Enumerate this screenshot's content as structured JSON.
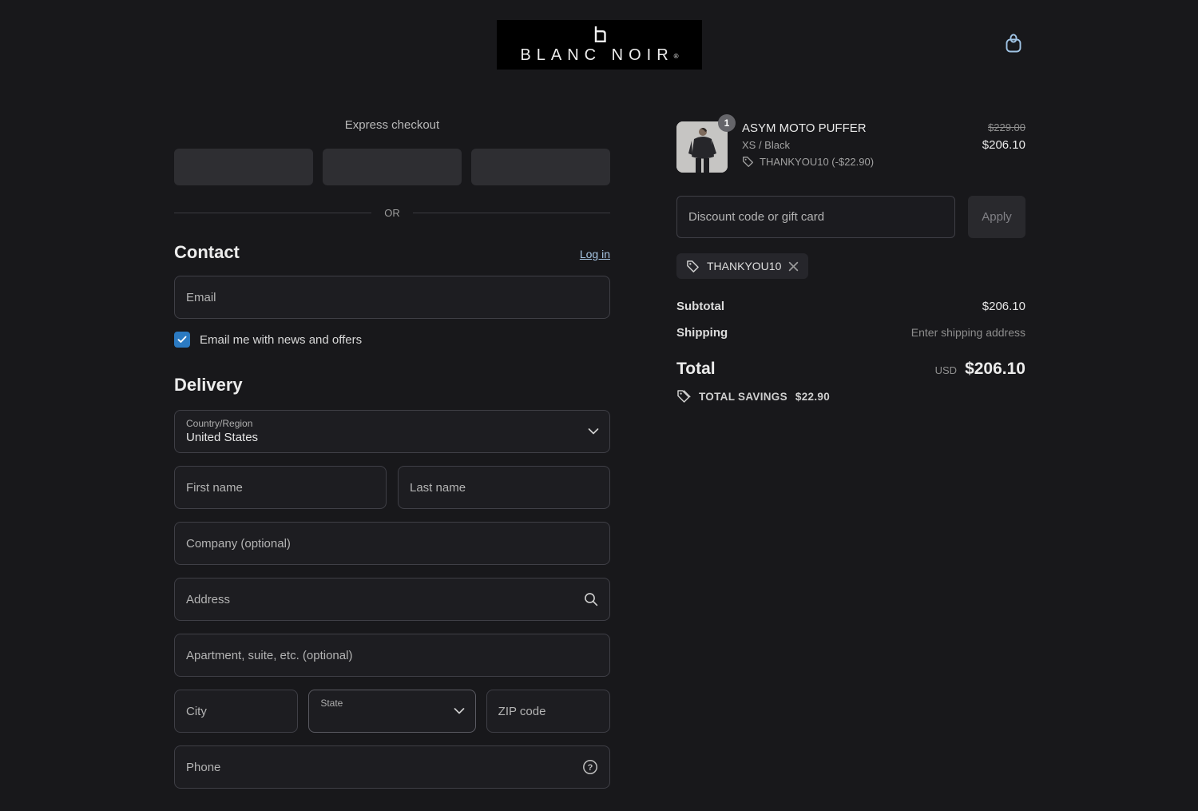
{
  "colors": {
    "page_bg": "#18181b",
    "field_bg": "#1d1d21",
    "field_border": "#3f3f46",
    "link_blue": "#a6c5e3",
    "checkbox_blue": "#2b7ac2",
    "cart_icon_blue": "#9fc3e4",
    "logo_bg": "#000000"
  },
  "header": {
    "brand": "BLANC NOIR",
    "registered_mark": "®"
  },
  "express": {
    "title": "Express checkout",
    "divider": "OR"
  },
  "contact": {
    "heading": "Contact",
    "login_link": "Log in",
    "email_placeholder": "Email",
    "newsletter_label": "Email me with news and offers"
  },
  "delivery": {
    "heading": "Delivery",
    "country_label": "Country/Region",
    "country_value": "United States",
    "first_name_placeholder": "First name",
    "last_name_placeholder": "Last name",
    "company_placeholder": "Company (optional)",
    "address_placeholder": "Address",
    "apartment_placeholder": "Apartment, suite, etc. (optional)",
    "city_placeholder": "City",
    "state_label": "State",
    "zip_placeholder": "ZIP code",
    "phone_placeholder": "Phone"
  },
  "summary": {
    "item": {
      "quantity": "1",
      "name": "ASYM MOTO PUFFER",
      "variant": "XS / Black",
      "discount_tag": "THANKYOU10 (-$22.90)",
      "price_original": "$229.00",
      "price_current": "$206.10"
    },
    "discount_placeholder": "Discount code or gift card",
    "apply_label": "Apply",
    "applied_code": "THANKYOU10",
    "subtotal_label": "Subtotal",
    "subtotal_value": "$206.10",
    "shipping_label": "Shipping",
    "shipping_value": "Enter shipping address",
    "total_label": "Total",
    "currency": "USD",
    "total_value": "$206.10",
    "savings_label": "TOTAL SAVINGS",
    "savings_value": "$22.90"
  }
}
